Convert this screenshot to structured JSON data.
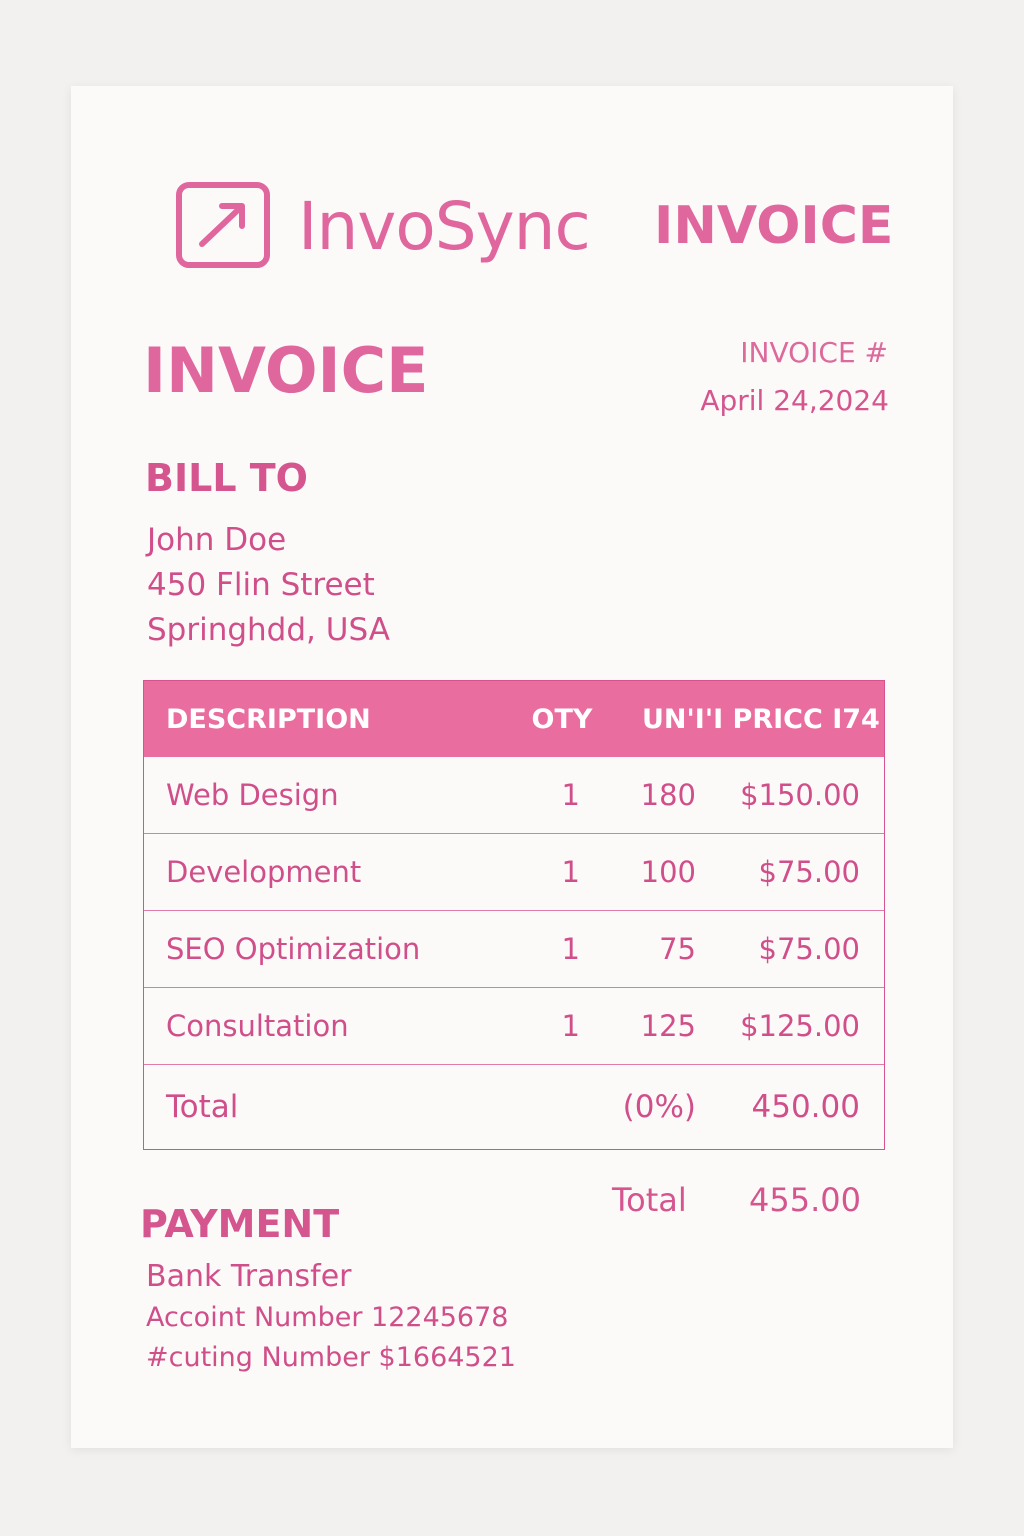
{
  "brand": {
    "name": "InvoSync",
    "logo_icon": "arrow-up-right-icon",
    "header_label": "INVOICE"
  },
  "invoice": {
    "title": "INVOICE",
    "number_label": "INVOICE #",
    "date": "April 24,2024"
  },
  "bill_to": {
    "title": "BILL TO",
    "name": "John Doe",
    "street": "450 Flin Street",
    "city": "Springhdd, USA"
  },
  "table": {
    "headers": {
      "description": "DESCRIPTION",
      "qty": "OTY",
      "unit_price": "UN'I'I PRICC I74"
    },
    "rows": [
      {
        "description": "Web Design",
        "qty": "1",
        "unit": "180",
        "amount": "$150.00"
      },
      {
        "description": "Development",
        "qty": "1",
        "unit": "100",
        "amount": "$75.00"
      },
      {
        "description": "SEO Optimization",
        "qty": "1",
        "unit": "75",
        "amount": "$75.00"
      },
      {
        "description": "Consultation",
        "qty": "1",
        "unit": "125",
        "amount": "$125.00"
      }
    ],
    "total_row": {
      "label": "Total",
      "tax": "(0%)",
      "value": "450.00"
    }
  },
  "grand_total": {
    "label": "Total",
    "value": "455.00"
  },
  "payment": {
    "title": "PAYMENT",
    "method": "Bank Transfer",
    "account": "Accoint Number 12245678",
    "routing": "#cuting Number $1664521"
  },
  "colors": {
    "accent": "#e0669e",
    "header_fill": "#ea6d9f",
    "text": "#d04f8a",
    "paper": "#fcfaf8",
    "background": "#f3f1ef"
  }
}
